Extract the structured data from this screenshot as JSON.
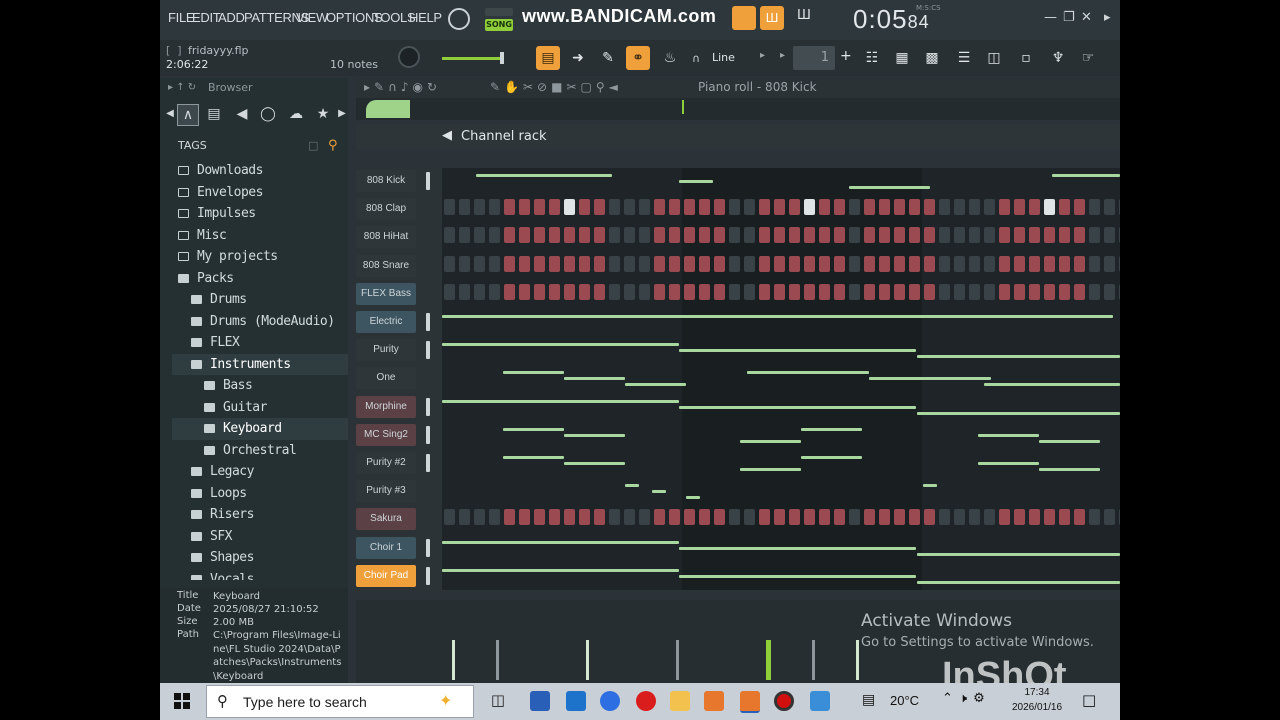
{
  "menu": {
    "items": [
      "FILE",
      "EDIT",
      "ADD",
      "PATTERNS",
      "VIEW",
      "OPTIONS",
      "TOOLS",
      "HELP"
    ],
    "song_label": "SONG",
    "recorder_watermark": "www.BANDICAM.com",
    "timer_main": "0:05",
    "timer_sub": "84",
    "timer_label": "M:S:CS"
  },
  "song_info": {
    "filename": "fridayyy.flp",
    "time": "2:06:22",
    "notes": "10 notes"
  },
  "toolbar": {
    "snap_label": "Line",
    "step_value": "1"
  },
  "browser": {
    "header": "Browser",
    "tags_label": "TAGS",
    "tree": [
      {
        "label": "Downloads",
        "indent": 0,
        "filled": false,
        "selected": false
      },
      {
        "label": "Envelopes",
        "indent": 0,
        "filled": false,
        "selected": false
      },
      {
        "label": "Impulses",
        "indent": 0,
        "filled": false,
        "selected": false
      },
      {
        "label": "Misc",
        "indent": 0,
        "filled": false,
        "selected": false
      },
      {
        "label": "My projects",
        "indent": 0,
        "filled": false,
        "selected": false
      },
      {
        "label": "Packs",
        "indent": 0,
        "filled": true,
        "selected": false
      },
      {
        "label": "Drums",
        "indent": 1,
        "filled": true,
        "selected": false
      },
      {
        "label": "Drums (ModeAudio)",
        "indent": 1,
        "filled": true,
        "selected": false
      },
      {
        "label": "FLEX",
        "indent": 1,
        "filled": true,
        "selected": false
      },
      {
        "label": "Instruments",
        "indent": 1,
        "filled": true,
        "selected": true
      },
      {
        "label": "Bass",
        "indent": 2,
        "filled": true,
        "selected": false
      },
      {
        "label": "Guitar",
        "indent": 2,
        "filled": true,
        "selected": false
      },
      {
        "label": "Keyboard",
        "indent": 2,
        "filled": true,
        "selected": true
      },
      {
        "label": "Orchestral",
        "indent": 2,
        "filled": true,
        "selected": false
      },
      {
        "label": "Legacy",
        "indent": 1,
        "filled": true,
        "selected": false
      },
      {
        "label": "Loops",
        "indent": 1,
        "filled": true,
        "selected": false
      },
      {
        "label": "Risers",
        "indent": 1,
        "filled": true,
        "selected": false
      },
      {
        "label": "SFX",
        "indent": 1,
        "filled": true,
        "selected": false
      },
      {
        "label": "Shapes",
        "indent": 1,
        "filled": true,
        "selected": false
      },
      {
        "label": "Vocals",
        "indent": 1,
        "filled": true,
        "selected": false
      }
    ],
    "info": {
      "title_key": "Title",
      "title_val": "Keyboard",
      "date_key": "Date",
      "date_val": "2025/08/27 21:10:52",
      "size_key": "Size",
      "size_val": "2.00 MB",
      "path_key": "Path",
      "path_val": "C:\\Program Files\\Image-Line\\FL Studio 2024\\Data\\Patches\\Packs\\Instruments\\Keyboard"
    }
  },
  "piano_roll_title": "Piano roll - 808 Kick",
  "channel_rack": {
    "title": "Channel rack",
    "add_label": "+",
    "channels": [
      {
        "name": "808 Kick",
        "style": "dark",
        "mode": "roll"
      },
      {
        "name": "808 Clap",
        "style": "dark",
        "mode": "steps"
      },
      {
        "name": "808 HiHat",
        "style": "dark",
        "mode": "steps"
      },
      {
        "name": "808 Snare",
        "style": "dark",
        "mode": "steps"
      },
      {
        "name": "FLEX Bass",
        "style": "blue",
        "mode": "steps"
      },
      {
        "name": "Electric",
        "style": "blue",
        "mode": "roll"
      },
      {
        "name": "Purity",
        "style": "dark",
        "mode": "roll"
      },
      {
        "name": "One",
        "style": "dark",
        "mode": "roll"
      },
      {
        "name": "Morphine",
        "style": "red",
        "mode": "roll"
      },
      {
        "name": "MC Sing2",
        "style": "red",
        "mode": "roll"
      },
      {
        "name": "Purity #2",
        "style": "dark",
        "mode": "roll"
      },
      {
        "name": "Purity #3",
        "style": "dark",
        "mode": "roll"
      },
      {
        "name": "Sakura",
        "style": "red",
        "mode": "steps"
      },
      {
        "name": "Choir 1",
        "style": "blue",
        "mode": "roll"
      },
      {
        "name": "Choir Pad",
        "style": "orange",
        "mode": "roll"
      }
    ]
  },
  "overlay": {
    "activate_title": "Activate Windows",
    "activate_sub": "Go to Settings to activate Windows.",
    "inshot": "InShOt"
  },
  "taskbar": {
    "search_placeholder": "Type here to search",
    "temperature": "20°C",
    "time": "17:34",
    "date": "2026/01/16"
  }
}
